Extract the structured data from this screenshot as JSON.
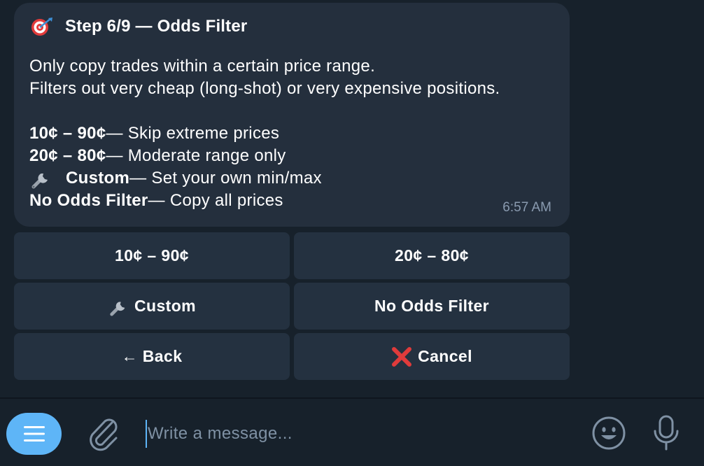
{
  "message": {
    "title": "Step 6/9 — Odds Filter",
    "line1": "Only copy trades within a certain price range.",
    "line2": "Filters out very cheap (long-shot) or very expensive positions.",
    "opt1_bold": "10¢ – 90¢",
    "opt1_rest": " — Skip extreme prices",
    "opt2_bold": "20¢ – 80¢",
    "opt2_rest": " — Moderate range only",
    "opt3_bold": "Custom",
    "opt3_rest": " — Set your own min/max",
    "opt4_bold": "No Odds Filter",
    "opt4_rest": " — Copy all prices",
    "time": "6:57 AM",
    "title_icon": "dart-target-icon",
    "custom_icon": "wrench-icon"
  },
  "keyboard": {
    "btn1": "10¢ – 90¢",
    "btn2": "20¢ – 80¢",
    "btn3": "Custom",
    "btn4": "No Odds Filter",
    "btn5": "← Back",
    "btn6": "Cancel"
  },
  "composer": {
    "placeholder": "Write a message..."
  },
  "colors": {
    "accent": "#5eb5f7",
    "bubble": "#242f3d",
    "background": "#17212b",
    "cancel_red": "#e03b3b"
  }
}
